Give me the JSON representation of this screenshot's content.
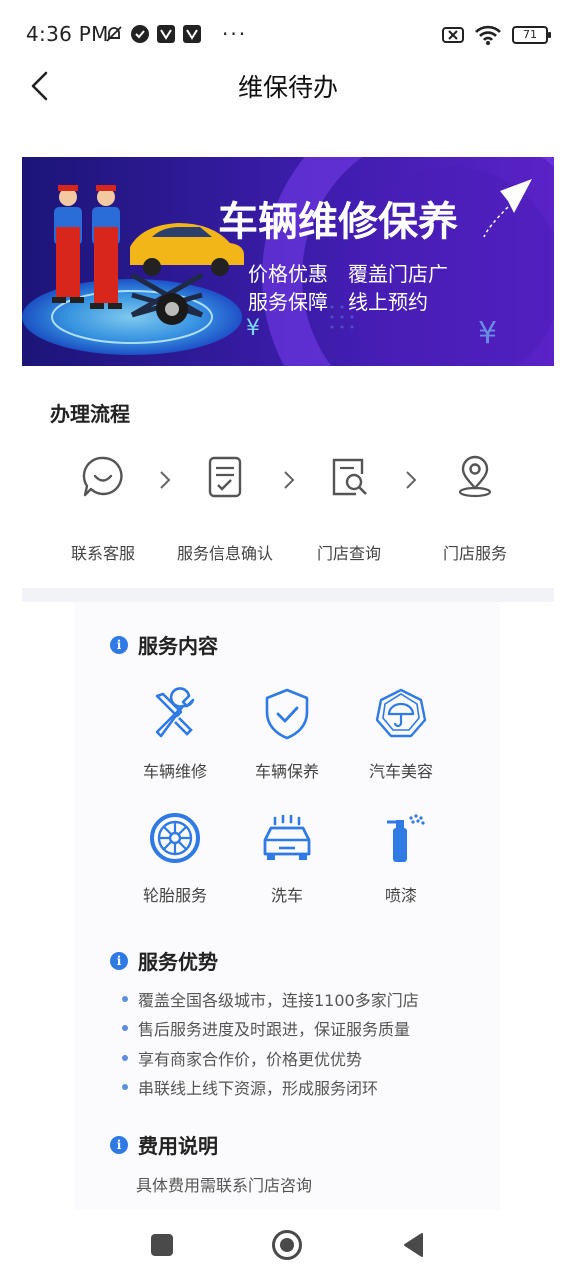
{
  "status_bar": {
    "time": "4:36 PM",
    "more": "···",
    "battery": "71"
  },
  "nav": {
    "title": "维保待办"
  },
  "banner": {
    "headline": "车辆维修保养",
    "line1": "价格优惠　覆盖门店广",
    "line2": "服务保障　线上预约",
    "yen": "¥"
  },
  "process": {
    "title": "办理流程",
    "steps": [
      {
        "label": "联系客服",
        "icon": "chat-bubble-icon"
      },
      {
        "label": "服务信息确认",
        "icon": "document-check-icon"
      },
      {
        "label": "门店查询",
        "icon": "store-search-icon"
      },
      {
        "label": "门店服务",
        "icon": "location-pin-icon"
      }
    ]
  },
  "services": {
    "title": "服务内容",
    "items": [
      {
        "label": "车辆维修",
        "icon": "wrench-screwdriver-icon"
      },
      {
        "label": "车辆保养",
        "icon": "shield-check-icon"
      },
      {
        "label": "汽车美容",
        "icon": "umbrella-badge-icon"
      },
      {
        "label": "轮胎服务",
        "icon": "tire-icon"
      },
      {
        "label": "洗车",
        "icon": "car-wash-icon"
      },
      {
        "label": "喷漆",
        "icon": "spray-can-icon"
      }
    ]
  },
  "advantages": {
    "title": "服务优势",
    "items": [
      "覆盖全国各级城市，连接1100多家门店",
      "售后服务进度及时跟进，保证服务质量",
      "享有商家合作价，价格更优优势",
      "串联线上线下资源，形成服务闭环"
    ]
  },
  "fees": {
    "title": "费用说明",
    "text": "具体费用需联系门店咨询"
  },
  "info_icon": "i",
  "colors": {
    "accent": "#2f7ae5",
    "banner_dark": "#1b1577",
    "banner_purple": "#6a2bd6"
  }
}
